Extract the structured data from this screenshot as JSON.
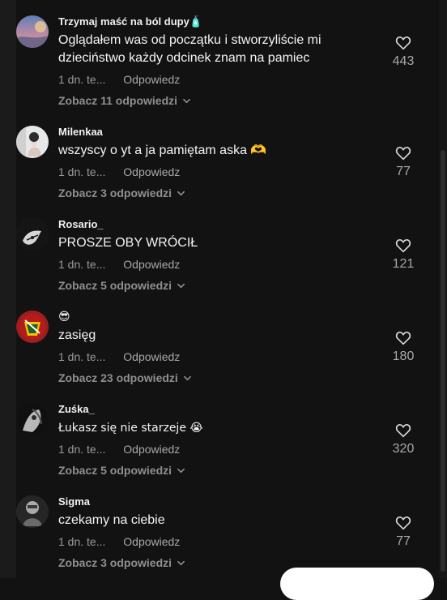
{
  "comments": [
    {
      "username": "Trzymaj maść na ból dupy🧴",
      "text": "Oglądałem was od początku i stworzyliście mi dzieciństwo każdy odcinek znam na pamiec",
      "time": "1 dn. te...",
      "reply": "Odpowiedz",
      "view": "Zobacz 11 odpowiedzi",
      "likes": "443",
      "avatar": "sunset-avatar"
    },
    {
      "username": "Milenkaa",
      "text": "wszyscy o yt a ja pamiętam aska 🫶",
      "time": "1 dn. te...",
      "reply": "Odpowiedz",
      "view": "Zobacz 3 odpowiedzi",
      "likes": "77",
      "avatar": "person-avatar"
    },
    {
      "username": "Rosario_",
      "text": "PROSZE OBY WRÓCIŁ",
      "time": "1 dn. te...",
      "reply": "Odpowiedz",
      "view": "Zobacz 5 odpowiedzi",
      "likes": "121",
      "avatar": "hand-avatar"
    },
    {
      "username": "😎",
      "text": "zasięg",
      "time": "1 dn. te...",
      "reply": "Odpowiedz",
      "view": "Zobacz 23 odpowiedzi",
      "likes": "180",
      "avatar": "crest-avatar"
    },
    {
      "username": "Zuśka_",
      "text": "Łukasz się nie starzeje 😭",
      "time": "1 dn. te...",
      "reply": "Odpowiedz",
      "view": "Zobacz 5 odpowiedzi",
      "likes": "320",
      "avatar": "dark-portrait-avatar"
    },
    {
      "username": "Sigma",
      "text": "czekamy na ciebie",
      "time": "1 dn. te...",
      "reply": "Odpowiedz",
      "view": "Zobacz 3 odpowiedzi",
      "likes": "77",
      "avatar": "grayscale-portrait-avatar"
    }
  ],
  "icons": {
    "heart": "heart-icon",
    "chevron": "chevron-down-icon"
  },
  "colors": {
    "background": "#121212",
    "text_primary": "#f4f4f4",
    "text_secondary": "#9a9a9a"
  }
}
